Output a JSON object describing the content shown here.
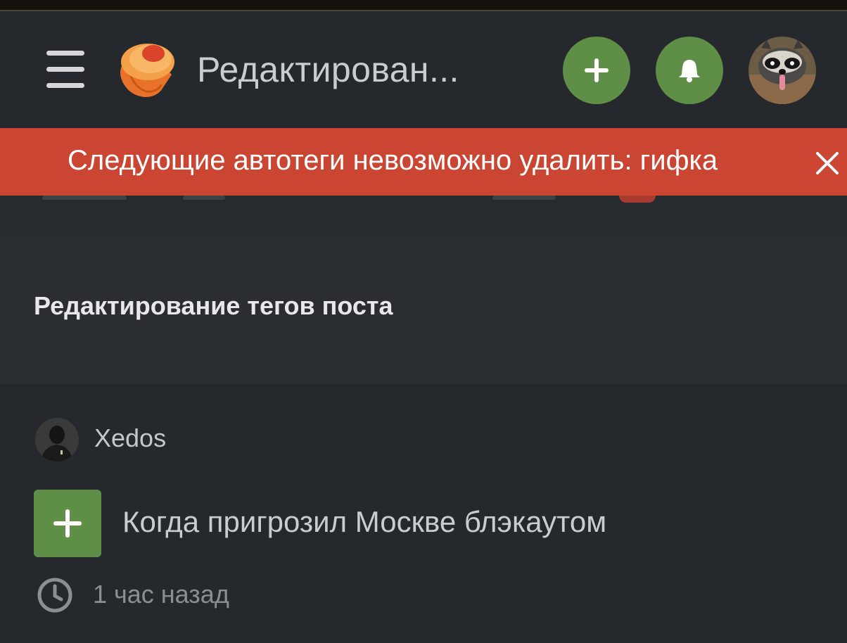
{
  "header": {
    "title": "Редактирован...",
    "menu_icon": "hamburger-icon",
    "logo_icon": "pikabu-logo-icon",
    "add_icon": "plus-icon",
    "notifications_icon": "bell-icon",
    "avatar_icon": "user-avatar"
  },
  "toast": {
    "message": "Следующие автотеги невозможно удалить: гифка",
    "close_icon": "close-icon"
  },
  "page": {
    "section_title": "Редактирование тегов поста"
  },
  "post": {
    "author": "Xedos",
    "title": "Когда пригрозил Москве блэкаутом",
    "time": "1 час назад",
    "expand_icon": "plus-icon",
    "time_icon": "clock-icon"
  },
  "colors": {
    "accent_green": "#5f8f47",
    "toast_red": "#cb4533",
    "header_bg": "#25292d",
    "page_bg": "#2a2d31"
  }
}
